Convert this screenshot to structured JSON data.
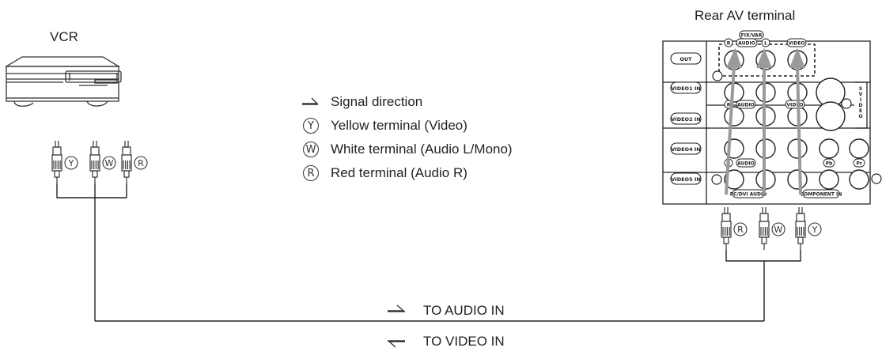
{
  "device_labels": {
    "vcr": "VCR",
    "rear_terminal": "Rear AV terminal"
  },
  "legend": [
    {
      "icon": "signal-arrow",
      "text": "Signal direction"
    },
    {
      "icon": "Y",
      "text": "Yellow terminal (Video)"
    },
    {
      "icon": "W",
      "text": "White terminal (Audio L/Mono)"
    },
    {
      "icon": "R",
      "text": "Red terminal (Audio R)"
    }
  ],
  "connections": {
    "audio_label": "TO AUDIO IN",
    "video_label": "TO VIDEO IN"
  },
  "vcr_plugs": [
    "Y",
    "W",
    "R"
  ],
  "tv_plugs": [
    "R",
    "W",
    "Y"
  ],
  "panel": {
    "rows": [
      "OUT",
      "VIDEO1 IN",
      "VIDEO2 IN",
      "VIDEO4 IN",
      "VIDEO5 IN"
    ],
    "labels": {
      "fix_var": "(FIX/VAR)",
      "audio": "AUDIO",
      "l": "L",
      "r": "R",
      "video": "VIDEO",
      "pb": "Pb",
      "pr": "Pr",
      "pc_dvi_audio": "PC/DVI AUDIO",
      "component_in": "COMPONENT IN",
      "s_video": "S-VIDEO"
    }
  },
  "colors": {
    "line": "#222222",
    "arrow": "#9a9a9a"
  }
}
